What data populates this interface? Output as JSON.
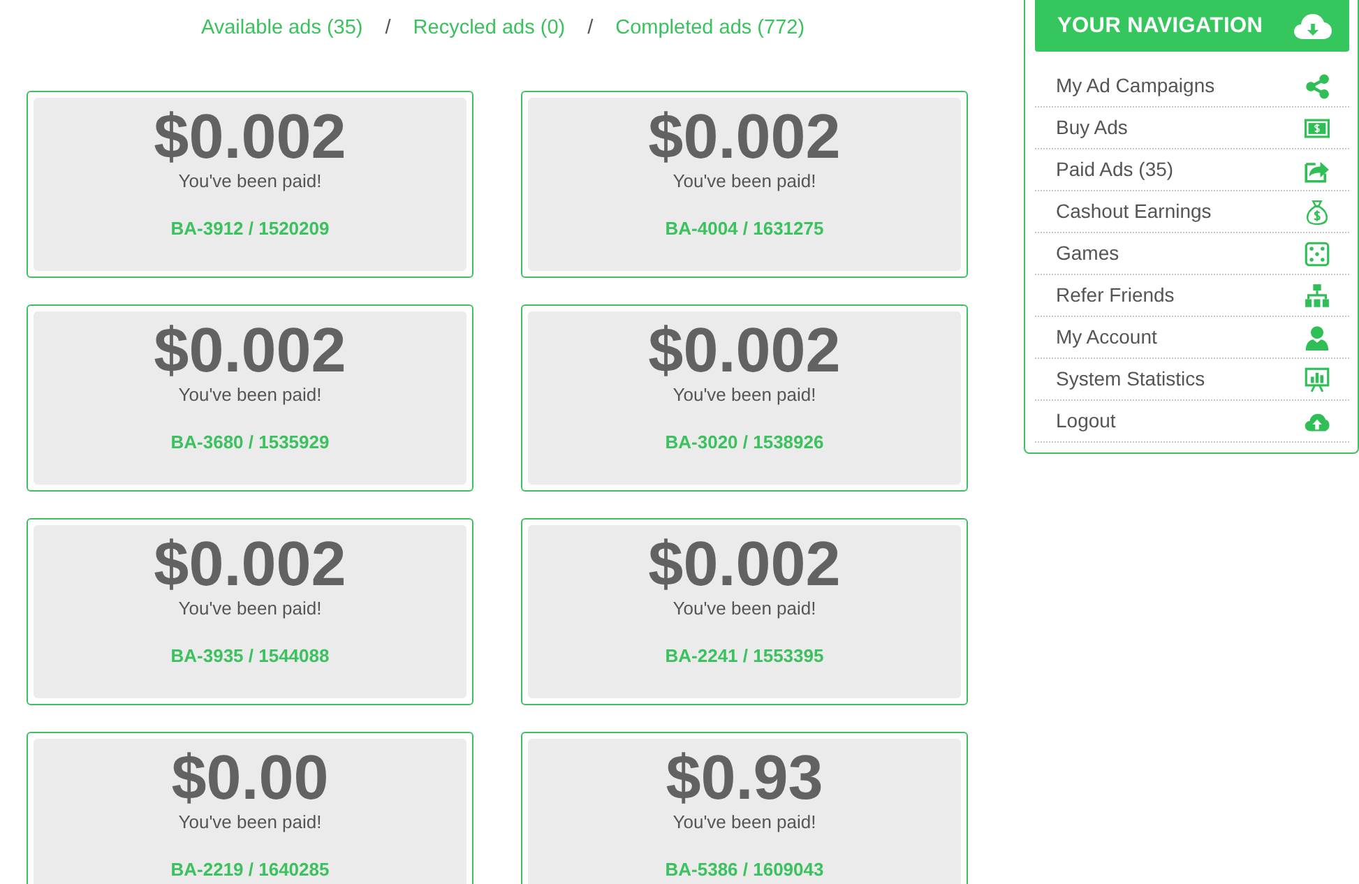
{
  "filter_links": [
    {
      "label": "Available ads (35)"
    },
    {
      "label": "Recycled ads (0)"
    },
    {
      "label": "Completed ads (772)"
    }
  ],
  "filter_separators": [
    "/",
    "/"
  ],
  "ads": [
    {
      "amount": "$0.002",
      "status": "You've been paid!",
      "reference": "BA-3912 / 1520209"
    },
    {
      "amount": "$0.002",
      "status": "You've been paid!",
      "reference": "BA-4004 / 1631275"
    },
    {
      "amount": "$0.002",
      "status": "You've been paid!",
      "reference": "BA-3680 / 1535929"
    },
    {
      "amount": "$0.002",
      "status": "You've been paid!",
      "reference": "BA-3020 / 1538926"
    },
    {
      "amount": "$0.002",
      "status": "You've been paid!",
      "reference": "BA-3935 / 1544088"
    },
    {
      "amount": "$0.002",
      "status": "You've been paid!",
      "reference": "BA-2241 / 1553395"
    },
    {
      "amount": "$0.00",
      "status": "You've been paid!",
      "reference": "BA-2219 / 1640285"
    },
    {
      "amount": "$0.93",
      "status": "You've been paid!",
      "reference": "BA-5386 / 1609043"
    }
  ],
  "navigation": {
    "title": "YOUR NAVIGATION",
    "items": [
      {
        "label": "My Ad Campaigns"
      },
      {
        "label": "Buy Ads"
      },
      {
        "label": "Paid Ads (35)"
      },
      {
        "label": "Cashout Earnings"
      },
      {
        "label": "Games"
      },
      {
        "label": "Refer Friends"
      },
      {
        "label": "My Account"
      },
      {
        "label": "System Statistics"
      },
      {
        "label": "Logout"
      }
    ]
  }
}
